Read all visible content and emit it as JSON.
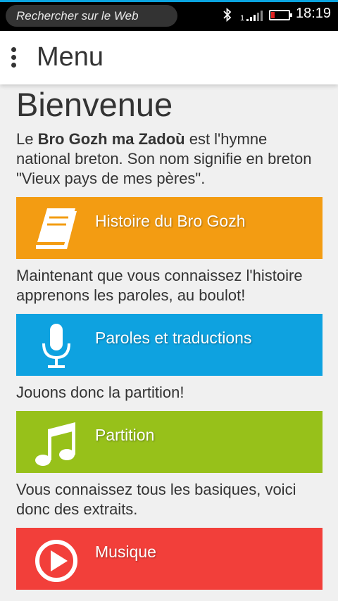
{
  "status_bar": {
    "search_placeholder": "Rechercher sur le Web",
    "sim_label": "1",
    "time": "18:19"
  },
  "header": {
    "title": "Menu"
  },
  "main": {
    "heading": "Bienvenue",
    "intro_pre": "Le ",
    "intro_bold": "Bro Gozh ma Zadoù",
    "intro_post": " est l'hymne national breton. Son nom signifie en breton \"Vieux pays de mes pères\".",
    "cards": [
      {
        "label": "Histoire du Bro Gozh",
        "color": "#f39c12",
        "icon": "book-icon"
      },
      {
        "label": "Paroles et traductions",
        "color": "#0ea2e0",
        "icon": "microphone-icon"
      },
      {
        "label": "Partition",
        "color": "#97c11a",
        "icon": "music-note-icon"
      },
      {
        "label": "Musique",
        "color": "#f23f3a",
        "icon": "play-icon"
      }
    ],
    "text_after_history": "Maintenant que vous connaissez l'histoire apprenons les paroles, au boulot!",
    "text_after_lyrics": "Jouons donc la partition!",
    "text_after_score": "Vous connaissez tous les basiques, voici donc des extraits."
  }
}
